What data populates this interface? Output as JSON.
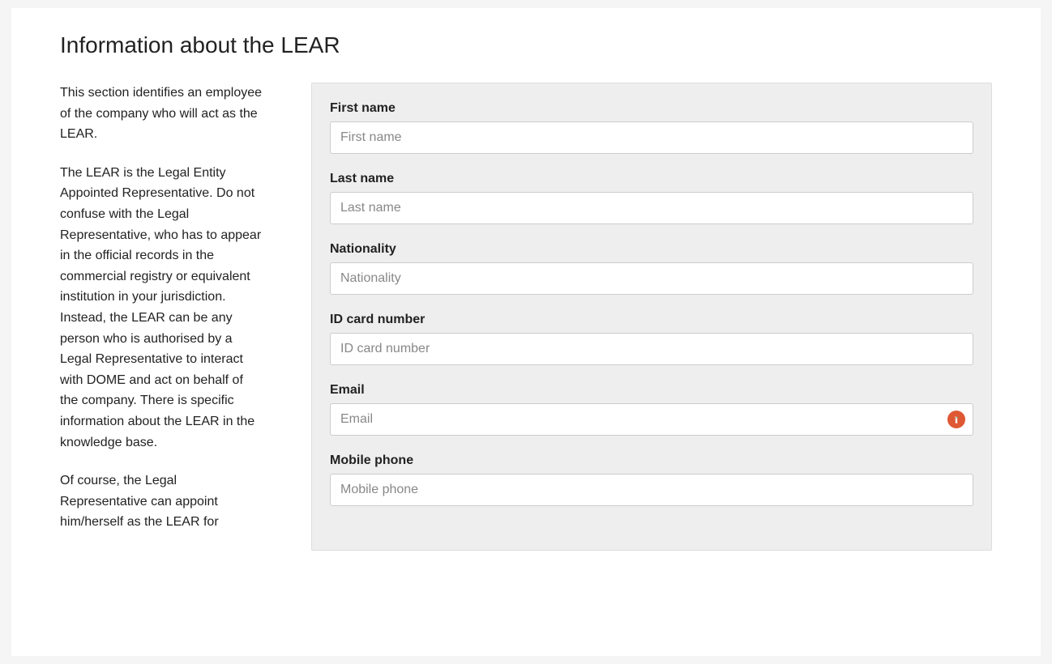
{
  "heading": "Information about the LEAR",
  "description": {
    "p1": "This section identifies an employee of the company who will act as the LEAR.",
    "p2": "The LEAR is the Legal Entity Appointed Representative. Do not confuse with the Legal Representative, who has to appear in the official records in the commercial registry or equivalent institution in your jurisdiction. Instead, the LEAR can be any person who is authorised by a Legal Representative to interact with DOME and act on behalf of the company. There is specific information about the LEAR in the knowledge base.",
    "p3": "Of course, the Legal Representative can appoint him/herself as the LEAR for"
  },
  "form": {
    "firstName": {
      "label": "First name",
      "placeholder": "First name"
    },
    "lastName": {
      "label": "Last name",
      "placeholder": "Last name"
    },
    "nationality": {
      "label": "Nationality",
      "placeholder": "Nationality"
    },
    "idCard": {
      "label": "ID card number",
      "placeholder": "ID card number"
    },
    "email": {
      "label": "Email",
      "placeholder": "Email"
    },
    "mobile": {
      "label": "Mobile phone",
      "placeholder": "Mobile phone"
    }
  }
}
